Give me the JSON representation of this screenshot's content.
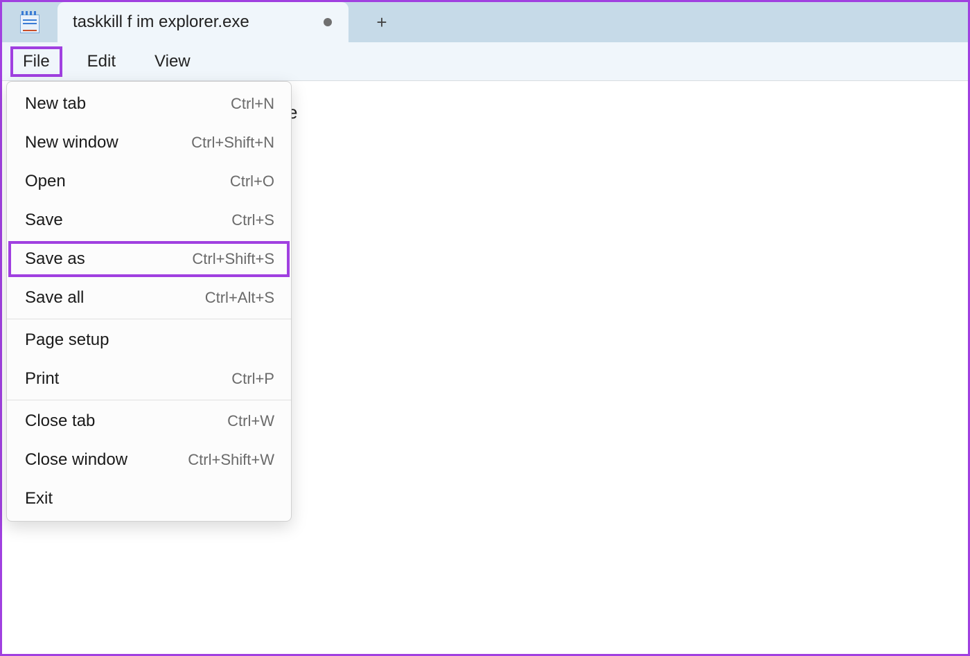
{
  "app": {
    "tab_title": "taskkill f im explorer.exe"
  },
  "menubar": {
    "file": "File",
    "edit": "Edit",
    "view": "View"
  },
  "editor": {
    "visible_text_peek": "e"
  },
  "file_menu": {
    "items": [
      {
        "label": "New tab",
        "shortcut": "Ctrl+N",
        "group": 1
      },
      {
        "label": "New window",
        "shortcut": "Ctrl+Shift+N",
        "group": 1
      },
      {
        "label": "Open",
        "shortcut": "Ctrl+O",
        "group": 1
      },
      {
        "label": "Save",
        "shortcut": "Ctrl+S",
        "group": 1
      },
      {
        "label": "Save as",
        "shortcut": "Ctrl+Shift+S",
        "group": 1,
        "highlighted": true
      },
      {
        "label": "Save all",
        "shortcut": "Ctrl+Alt+S",
        "group": 1
      },
      {
        "label": "Page setup",
        "shortcut": "",
        "group": 2
      },
      {
        "label": "Print",
        "shortcut": "Ctrl+P",
        "group": 2
      },
      {
        "label": "Close tab",
        "shortcut": "Ctrl+W",
        "group": 3
      },
      {
        "label": "Close window",
        "shortcut": "Ctrl+Shift+W",
        "group": 3
      },
      {
        "label": "Exit",
        "shortcut": "",
        "group": 3
      }
    ]
  },
  "annotations": {
    "highlight_color": "#a040e0"
  }
}
